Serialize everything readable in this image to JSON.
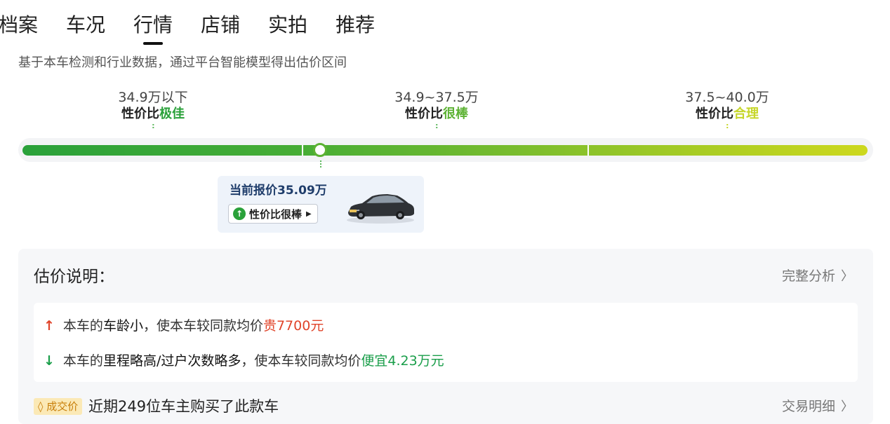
{
  "tabs": [
    {
      "label": "档案"
    },
    {
      "label": "车况"
    },
    {
      "label": "行情",
      "active": true
    },
    {
      "label": "店铺"
    },
    {
      "label": "实拍"
    },
    {
      "label": "推荐"
    }
  ],
  "subtitle": "基于本车检测和行业数据，通过平台智能模型得出估价区间",
  "ranges": [
    {
      "price": "34.9万以下",
      "level_prefix": "性价比",
      "level_word": "极佳",
      "color": "#2aa13a"
    },
    {
      "price": "34.9~37.5万",
      "level_prefix": "性价比",
      "level_word": "很棒",
      "color": "#5cb233"
    },
    {
      "price": "37.5~40.0万",
      "level_prefix": "性价比",
      "level_word": "合理",
      "color": "#c6d629"
    }
  ],
  "current": {
    "price_text": "当前报价35.09万",
    "badge_label": "性价比很棒",
    "badge_icon": "arrow-up-circle-icon",
    "badge_color": "#2aa13a"
  },
  "explain": {
    "title": "估价说明：",
    "link": "完整分析",
    "reasons": [
      {
        "direction": "up",
        "pre": "本车的",
        "em": "车龄小",
        "mid": "，使本车较同款均价",
        "value": "贵7700元",
        "color": "#e0442a"
      },
      {
        "direction": "down",
        "pre": "本车的",
        "em": "里程略高/过户次数略多",
        "mid": "，使本车较同款均价",
        "value": "便宜4.23万元",
        "color": "#1a9e4a"
      }
    ],
    "deal_tag": "成交价",
    "deal_text": "近期249位车主购买了此款车",
    "deal_link": "交易明细"
  }
}
